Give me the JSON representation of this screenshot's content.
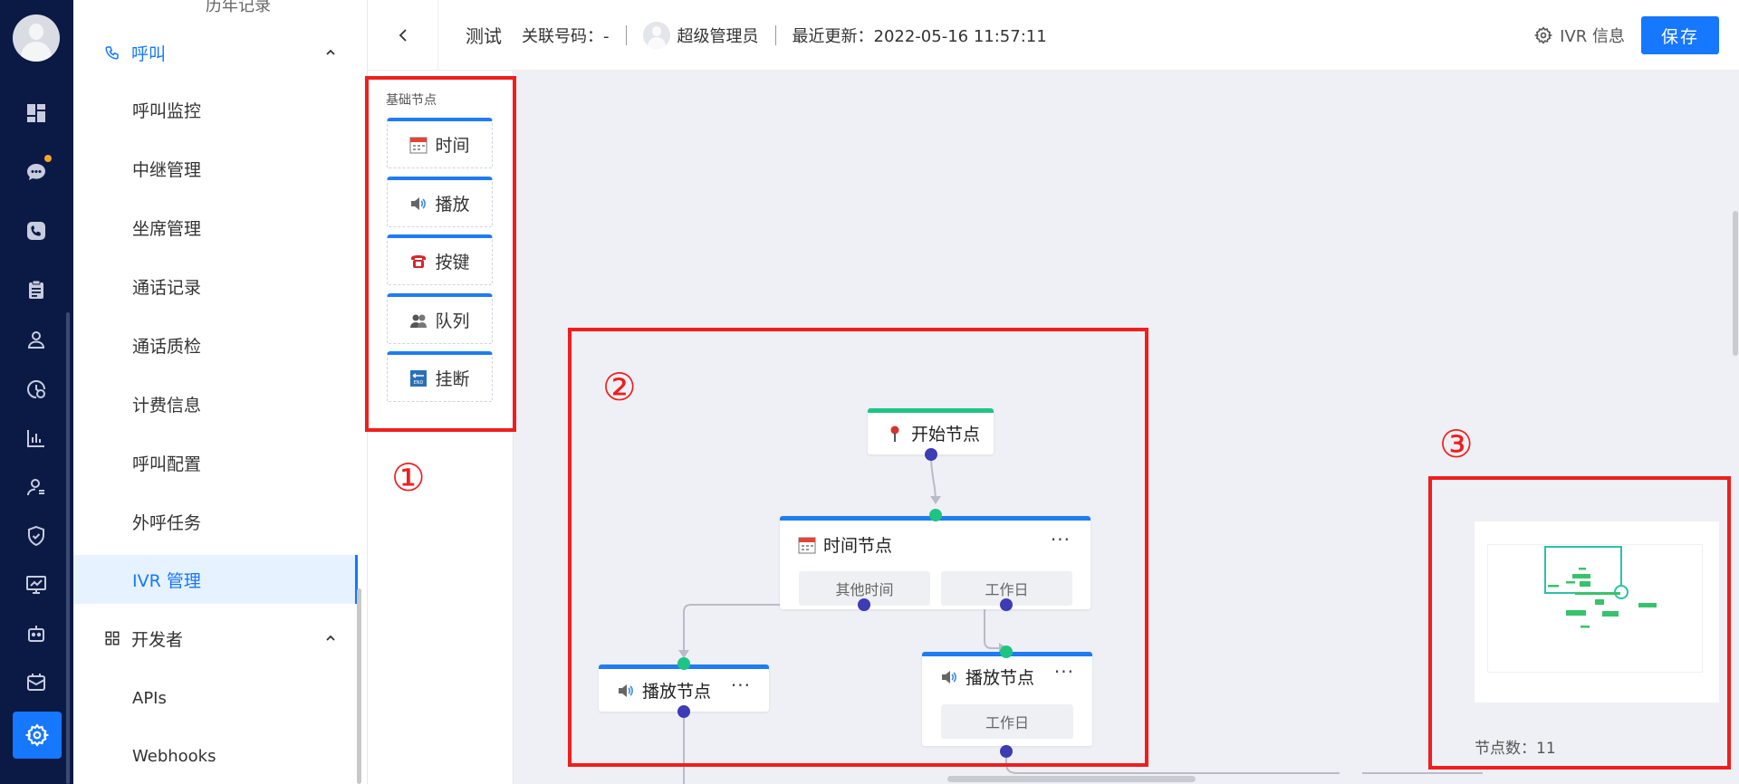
{
  "topbar": {
    "flow_name": "测试",
    "related_number_label": "关联号码：-",
    "user_name": "超级管理员",
    "last_update": "最近更新：2022-05-16 11:57:11",
    "ivr_info_label": "IVR 信息",
    "save_label": "保存"
  },
  "sidebar": {
    "cut_item": "历年记录",
    "group_call": "呼叫",
    "items": [
      "呼叫监控",
      "中继管理",
      "坐席管理",
      "通话记录",
      "通话质检",
      "计费信息",
      "呼叫配置",
      "外呼任务",
      "IVR 管理"
    ],
    "group_dev": "开发者",
    "dev_items": [
      "APIs",
      "Webhooks"
    ]
  },
  "palette": {
    "title": "基础节点",
    "nodes": [
      "时间",
      "播放",
      "按键",
      "队列",
      "挂断"
    ]
  },
  "flow": {
    "start_node": "开始节点",
    "time_node": "时间节点",
    "time_branches": [
      "其他时间",
      "工作日"
    ],
    "play_node_left": "播放节点",
    "play_node_right": "播放节点",
    "play_right_branch": "工作日",
    "more": "···"
  },
  "minimap": {
    "node_count": "节点数：11"
  },
  "annotations": [
    "①",
    "②",
    "③"
  ],
  "colors": {
    "accent": "#1677ff",
    "rail_bg": "#0b1a45",
    "annotation_red": "#f01e1e",
    "port_in": "#1fc485",
    "port_out": "#3c3cb4"
  }
}
